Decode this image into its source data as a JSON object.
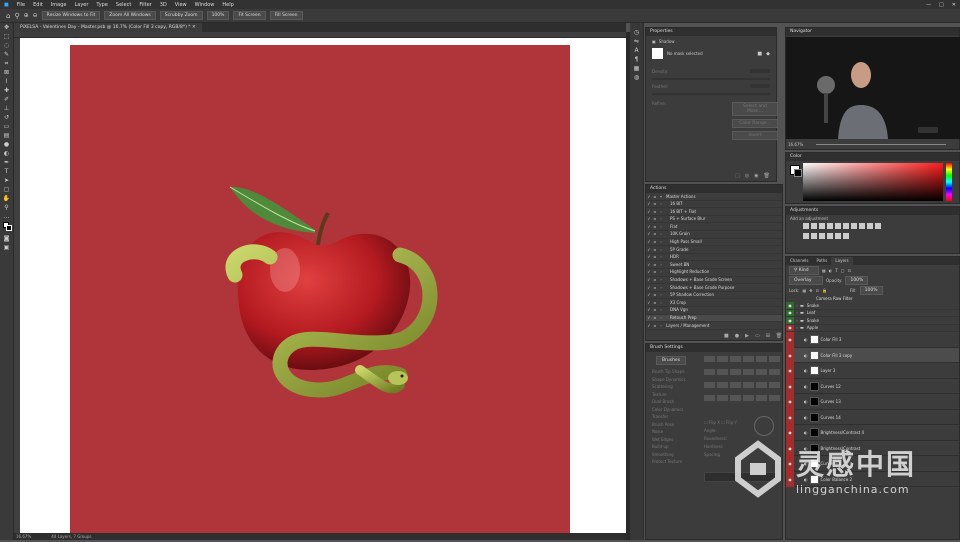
{
  "menu": [
    "File",
    "Edit",
    "Image",
    "Layer",
    "Type",
    "Select",
    "Filter",
    "3D",
    "View",
    "Window",
    "Help"
  ],
  "options": {
    "resize_windows": "Resize Windows to Fit",
    "zoom_all": "Zoom All Windows",
    "scrubby_zoom": "Scrubby Zoom",
    "zoom_pct": "100%",
    "fit_screen": "Fit Screen",
    "fill_screen": "Fill Screen"
  },
  "document": {
    "tab": "PiXELSA - Valentines Day - Master.psb @ 16.7% (Color Fill 3 copy, RGB/8*) *",
    "bg_color": "#b0353a"
  },
  "status": {
    "zoom": "16.67%",
    "info": "44 Layers, 7 Groups"
  },
  "properties": {
    "title": "Properties",
    "subtitle": "Shadow",
    "no_mask": "No mask selected",
    "density": "Density:",
    "feather": "Feather:",
    "refine": "Refine:",
    "select_mask": "Select and Mask...",
    "color_range": "Color Range...",
    "invert": "Invert"
  },
  "actions": {
    "title": "Actions",
    "items": [
      "Master Actions",
      "16 BIT",
      "16 BIT + Flat",
      "PS + Surface Blur",
      "Flat",
      "10K Grain",
      "High Pass Small",
      "5P Grade",
      "HDR",
      "Sweet BN",
      "Highlight Reduction",
      "Shadows + Base Grade Screen",
      "Shadows + Base Grade Purpose",
      "5P Shadow Correction",
      "X3 Crop",
      "DNA Vgn",
      "Retouch Prep",
      "Layers / Management"
    ]
  },
  "brush_settings": {
    "title": "Brush Settings",
    "brushes_btn": "Brushes",
    "options": [
      "Brush Tip Shape",
      "Shape Dynamics",
      "Scattering",
      "Texture",
      "Dual Brush",
      "Color Dynamics",
      "Transfer",
      "Brush Pose",
      "Noise",
      "Wet Edges",
      "Build-up",
      "Smoothing",
      "Protect Texture"
    ],
    "flip_x": "Flip X",
    "flip_y": "Flip Y",
    "angle": "Angle:",
    "roundness": "Roundness:",
    "hardness": "Hardness",
    "spacing": "Spacing"
  },
  "navigator": {
    "title": "Navigator",
    "zoom": "16.67%"
  },
  "color": {
    "title": "Color"
  },
  "adjustments": {
    "title": "Adjustments",
    "subtitle": "Add an adjustment"
  },
  "layers": {
    "tabs": [
      "Channels",
      "Paths",
      "Layers"
    ],
    "kind": "Kind",
    "blend": "Overlay",
    "opacity_label": "Opacity:",
    "opacity": "100%",
    "lock_label": "Lock:",
    "fill_label": "Fill:",
    "fill": "100%",
    "items": [
      {
        "name": "Camera Raw Filter",
        "type": "text"
      },
      {
        "name": "Snake",
        "type": "group"
      },
      {
        "name": "Leaf",
        "type": "group"
      },
      {
        "name": "Snake",
        "type": "group"
      },
      {
        "name": "Apple",
        "type": "group"
      },
      {
        "name": "Color Fill 3",
        "type": "white"
      },
      {
        "name": "Color Fill 3 copy",
        "type": "white"
      },
      {
        "name": "Layer 3",
        "type": "white"
      },
      {
        "name": "Curves 12",
        "type": "black"
      },
      {
        "name": "Curves 13",
        "type": "black"
      },
      {
        "name": "Curves 14",
        "type": "black"
      },
      {
        "name": "Brightness/Contrast 4",
        "type": "black"
      },
      {
        "name": "Brightness/Contrast",
        "type": "black"
      },
      {
        "name": "Curves 11",
        "type": "white"
      },
      {
        "name": "Color Balance 2",
        "type": "white"
      }
    ]
  },
  "watermark": {
    "cn": "灵感中国",
    "url": "lingganchina.com"
  }
}
